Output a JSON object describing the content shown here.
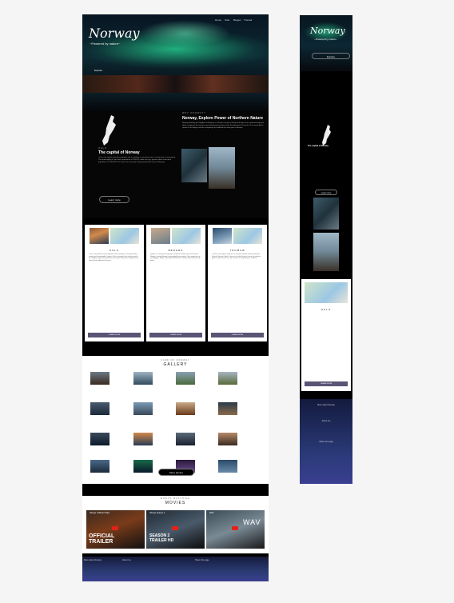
{
  "desktop": {
    "nav": [
      "Home",
      "Oslo",
      "Bergen",
      "Tromsø"
    ],
    "hero": {
      "title": "Norway",
      "subtitle": "~Powered by nature~",
      "explore": "Explore"
    },
    "intro": {
      "kicker": "WHY NORWAY?",
      "title": "Norway, Explore Power of Northern Nature",
      "text": "Norway, officially the Kingdom of Norway, is a Nordic country in Northern Europe, the mainland territory of which comprises the western and northernmost portion of the Scandinavian Peninsula. The remote Arctic island of Jan Mayen and the archipelago of Svalbard also form part of Norway."
    },
    "capital": {
      "kicker": "OSLO",
      "title": "The capital of Norway",
      "text": "Oslo is the capital and most populous city of Norway. It constitutes both a county and a municipality. The municipality of Oslo had a population of 709,037, while the city's greater urban area had a population of 1,064,235. The city is the economic and governmental centre of Norway.",
      "button": "Learn more"
    },
    "cards": [
      {
        "title": "OSLO",
        "text": "Oslo is the capital and most populous city of Norway. It constitutes both a county and a municipality. Location Oslo is situated at the northern end of the Oslofjord. Upper Holmenkollen and Tryvann. Attractions Vigeland Park, Opera House, Akershus Fortress.",
        "button": "LEARN MORE"
      },
      {
        "title": "BERGEN",
        "text": "Bergen is a city and municipality in Vestland county on the west coast of Norway. Location Bergen is surrounded by mountains. Your suggestions to visit Bryggen, Fløyen, Fish Market. Attractions Colourful wharf houses and fjords.",
        "button": "LEARN MORE"
      },
      {
        "title": "TROMSØ",
        "text": "Tromsø is the largest urban area in Northern Norway. Fjords, Mountains, Forests, Northern Lights. Tromsø is an ideal location to view the northern lights. Did you know? The city is known as the gateway to the Arctic.",
        "button": "LEARN MORE"
      }
    ],
    "gallery": {
      "kicker": "VIEW OF NORWAY",
      "title": "GALLERY",
      "more": "More photos"
    },
    "movies": {
      "kicker": "WORTH WATCHING",
      "title": "MOVIES",
      "videos": [
        {
          "title": "Vikings | Official Trailer",
          "overlay": "OFFICIAL TRAILER"
        },
        {
          "title": "Vikings Season 2",
          "overlay": "SEASON 2 TRAILER HD"
        },
        {
          "title": "WAV",
          "overlay": "WAV"
        }
      ]
    },
    "footer": {
      "col1": "More about Norway",
      "col2": "About me",
      "col3": "Share this page"
    }
  },
  "mobile": {
    "hero": {
      "title": "Norway",
      "subtitle": "~Powered by nature~",
      "explore": "Explore"
    },
    "capital_title": "The capital of Norway",
    "learn": "Learn more",
    "card_title": "OSLO",
    "card_button": "LEARN MORE",
    "footer": [
      "More about Norway",
      "About me",
      "Share this page"
    ]
  }
}
